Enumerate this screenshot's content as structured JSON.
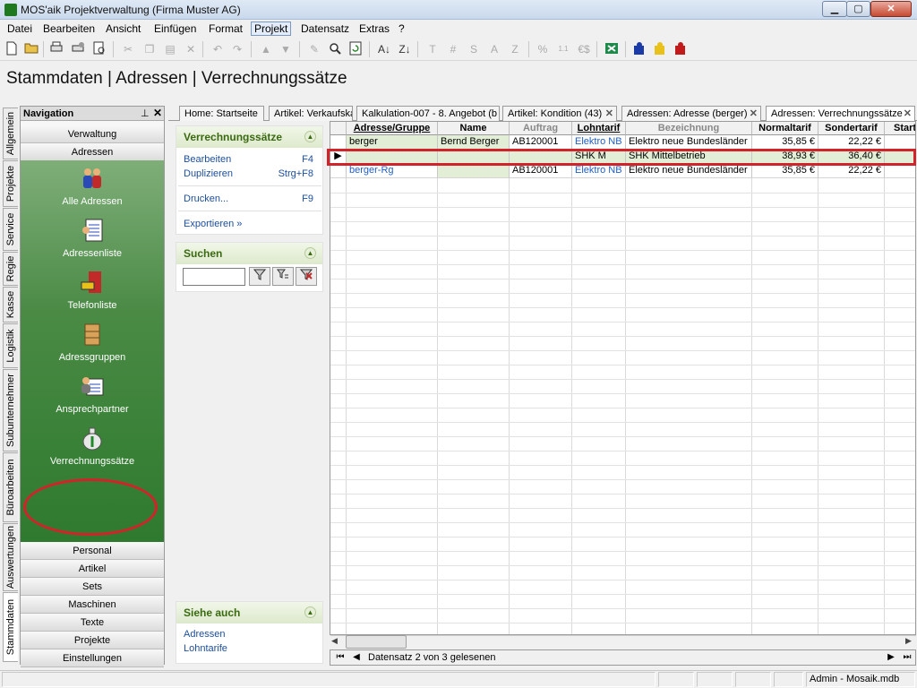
{
  "window": {
    "title": "MOS'aik Projektverwaltung (Firma Muster AG)",
    "min": "▁",
    "max": "▢",
    "close": "✕"
  },
  "menu": [
    "Datei",
    "Bearbeiten",
    "Ansicht",
    "Einfügen",
    "Format",
    "Projekt",
    "Datensatz",
    "Extras",
    "?"
  ],
  "toolbar": {
    "icons": [
      "new-icon",
      "open-icon",
      "print-icon",
      "print-setup-icon",
      "print-preview-icon",
      "cut-icon",
      "copy-icon",
      "paste-icon",
      "delete-icon",
      "undo-icon",
      "redo-icon",
      "arrow-up-icon",
      "arrow-down-icon",
      "pencil-icon",
      "find-icon",
      "refresh-icon",
      "sort-asc-icon",
      "sort-desc-icon",
      "text-t-icon",
      "hash-icon",
      "s-icon",
      "a-icon",
      "z-icon",
      "percent-icon",
      "decimals-icon",
      "currency-icon",
      "export-icon",
      "puzzle-blue-icon",
      "puzzle-yellow-icon",
      "puzzle-red-icon"
    ],
    "glyphs": {
      "text-t": "T",
      "hash": "#",
      "s": "S",
      "a": "A",
      "z": "Z",
      "percent": "%",
      "decimals": "1.1",
      "currency": "€$"
    }
  },
  "heading": "Stammdaten | Adressen | Verrechnungssätze",
  "side_tabs": [
    "Allgemein",
    "Projekte",
    "Service",
    "Regie",
    "Kasse",
    "Logistik",
    "Subunternehmer",
    "Büroarbeiten",
    "Auswertungen",
    "Stammdaten"
  ],
  "navigation": {
    "title": "Navigation",
    "pin": "⊥",
    "close": "✕",
    "top_groups": [
      "Verwaltung",
      "Adressen"
    ],
    "items": [
      "Alle Adressen",
      "Adressenliste",
      "Telefonliste",
      "Adressgruppen",
      "Ansprechpartner",
      "Verrechnungssätze"
    ],
    "bottom_groups": [
      "Personal",
      "Artikel",
      "Sets",
      "Maschinen",
      "Texte",
      "Projekte",
      "Einstellungen"
    ]
  },
  "task_panels": {
    "verrechnung": {
      "title": "Verrechnungssätze",
      "bearbeiten": "Bearbeiten",
      "bearbeiten_key": "F4",
      "duplizieren": "Duplizieren",
      "duplizieren_key": "Strg+F8",
      "drucken": "Drucken...",
      "drucken_key": "F9",
      "exportieren": "Exportieren »"
    },
    "suchen": {
      "title": "Suchen",
      "value": ""
    },
    "siehe_auch": {
      "title": "Siehe auch",
      "links": [
        "Adressen",
        "Lohntarife"
      ]
    }
  },
  "doc_tabs": [
    {
      "label": "Home: Startseite"
    },
    {
      "label": "Artikel: Verkaufskalkulation"
    },
    {
      "label": "Kalkulation-007 - 8. Angebot (b"
    },
    {
      "label": "Artikel: Kondition (43)"
    },
    {
      "label": "Adressen: Adresse (berger)"
    },
    {
      "label": "Adressen: Verrechnungssätze"
    }
  ],
  "grid": {
    "columns": [
      "Adresse/Gruppe",
      "Name",
      "Auftrag",
      "Lohntarif",
      "Bezeichnung",
      "Normaltarif",
      "Sondertarif",
      "Start"
    ],
    "rows": [
      [
        "berger",
        "Bernd Berger",
        "AB120001",
        "Elektro NB",
        "Elektro neue Bundesländer",
        "35,85 €",
        "22,22 €",
        ""
      ],
      [
        "",
        "",
        "",
        "SHK M",
        "SHK Mittelbetrieb",
        "38,93 €",
        "36,40 €",
        ""
      ],
      [
        "berger-Rg",
        "",
        "AB120001",
        "Elektro NB",
        "Elektro neue Bundesländer",
        "35,85 €",
        "22,22 €",
        ""
      ]
    ],
    "current_row_marker": "▶",
    "record_status": "Datensatz 2 von 3 gelesenen"
  },
  "status": {
    "user": "Admin - Mosaik.mdb"
  },
  "colors": {
    "nav_green": "#2e7a2e",
    "highlight": "#d2232a",
    "link_blue": "#1c4fa0"
  }
}
